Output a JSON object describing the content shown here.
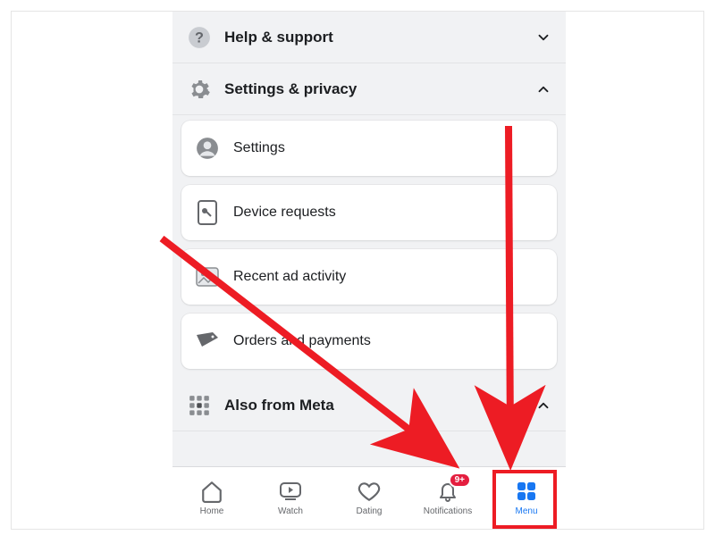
{
  "sections": {
    "help": {
      "label": "Help & support",
      "expanded": false
    },
    "settings_privacy": {
      "label": "Settings & privacy",
      "expanded": true
    },
    "also_meta": {
      "label": "Also from Meta",
      "expanded": true
    }
  },
  "settings_items": [
    {
      "label": "Settings"
    },
    {
      "label": "Device requests"
    },
    {
      "label": "Recent ad activity"
    },
    {
      "label": "Orders and payments"
    }
  ],
  "tabs": {
    "home": "Home",
    "watch": "Watch",
    "dating": "Dating",
    "notifications": "Notifications",
    "notifications_badge": "9+",
    "menu": "Menu"
  },
  "colors": {
    "accent": "#1877f2",
    "highlight": "#ed1c24",
    "badge": "#e41e3f"
  }
}
